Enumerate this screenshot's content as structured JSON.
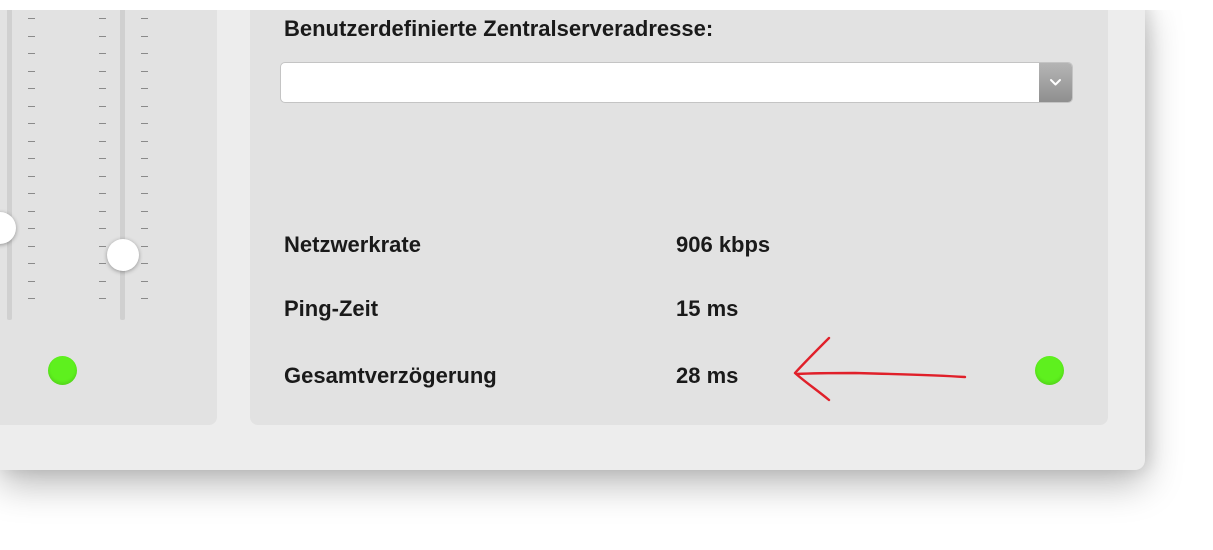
{
  "server": {
    "label": "Benutzerdefinierte Zentralserveradresse:",
    "value": ""
  },
  "stats": {
    "network_rate_label": "Netzwerkrate",
    "network_rate_value": "906 kbps",
    "ping_label": "Ping-Zeit",
    "ping_value": "15 ms",
    "delay_label": "Gesamtverzögerung",
    "delay_value": "28 ms"
  },
  "faders": [
    {
      "level": 0.28
    },
    {
      "level": 0.24
    }
  ],
  "colors": {
    "led_ok": "#5ef01e",
    "annotation": "#e0202a"
  },
  "icons": {
    "select_arrow": "chevron-down-icon",
    "annotation": "arrow-left-icon"
  }
}
